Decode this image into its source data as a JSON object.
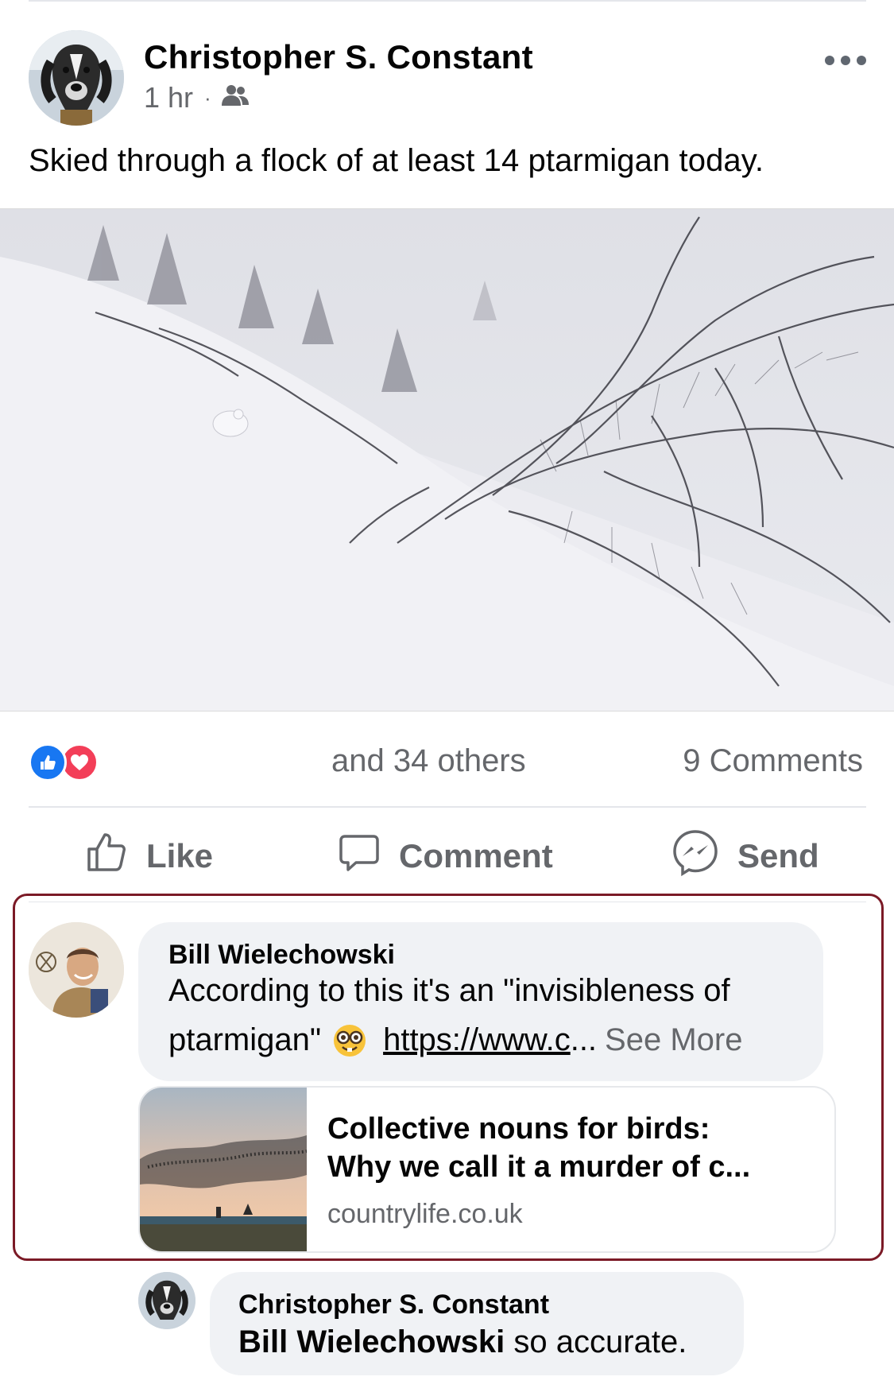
{
  "post": {
    "author": "Christopher S. Constant",
    "time": "1 hr",
    "separator": "·",
    "audience_icon": "friends-icon",
    "text": "Skied through a flock of at least 14 ptarmigan today.",
    "more_icon": "more-horizontal-icon"
  },
  "reactions": {
    "icons": [
      "like-reaction-icon",
      "love-reaction-icon"
    ],
    "count_text": "and 34 others",
    "comments_text": "9 Comments"
  },
  "actions": {
    "like": "Like",
    "comment": "Comment",
    "send": "Send"
  },
  "comment": {
    "author": "Bill Wielechowski",
    "line1": "According to this it's an \"invisibleness of",
    "line2_text": "ptarmigan\"",
    "emoji": "nerd-face-icon",
    "link": "https://www.c",
    "ellipsis": "...",
    "see_more": "See More",
    "preview": {
      "title_line1": "Collective nouns for birds:",
      "title_line2": "Why we call it a murder of c...",
      "domain": "countrylife.co.uk"
    }
  },
  "reply": {
    "author": "Christopher S. Constant",
    "mention": "Bill Wielechowski",
    "text": " so accurate."
  },
  "colors": {
    "secondary_text": "#65676b",
    "bubble_bg": "#f0f2f5",
    "like_blue": "#1877f2",
    "love_red": "#f33e58",
    "highlight_border": "#7b1a26"
  }
}
